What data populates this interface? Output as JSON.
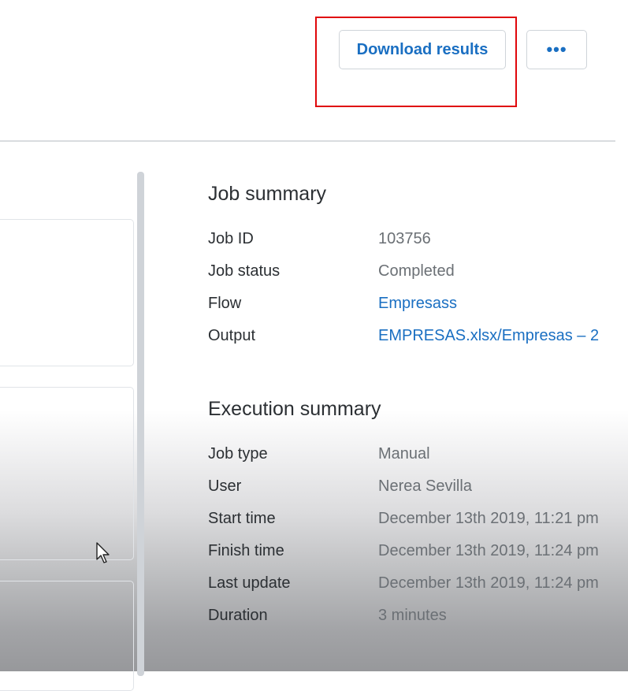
{
  "toolbar": {
    "download_label": "Download results",
    "more_label": "•••"
  },
  "job_summary": {
    "title": "Job summary",
    "rows": [
      {
        "label": "Job ID",
        "value": "103756"
      },
      {
        "label": "Job status",
        "value": "Completed"
      },
      {
        "label": "Flow",
        "value": "Empresass"
      },
      {
        "label": "Output",
        "value": "EMPRESAS.xlsx/Empresas – 2"
      }
    ]
  },
  "execution_summary": {
    "title": "Execution summary",
    "rows": [
      {
        "label": "Job type",
        "value": "Manual"
      },
      {
        "label": "User",
        "value": "Nerea Sevilla"
      },
      {
        "label": "Start time",
        "value": "December 13th 2019, 11:21 pm"
      },
      {
        "label": "Finish time",
        "value": "December 13th 2019, 11:24 pm"
      },
      {
        "label": "Last update",
        "value": "December 13th 2019, 11:24 pm"
      },
      {
        "label": "Duration",
        "value": "3 minutes"
      }
    ]
  },
  "colors": {
    "link": "#1a6fc2",
    "highlight": "#e0070b",
    "muted_text": "#6b7075"
  }
}
